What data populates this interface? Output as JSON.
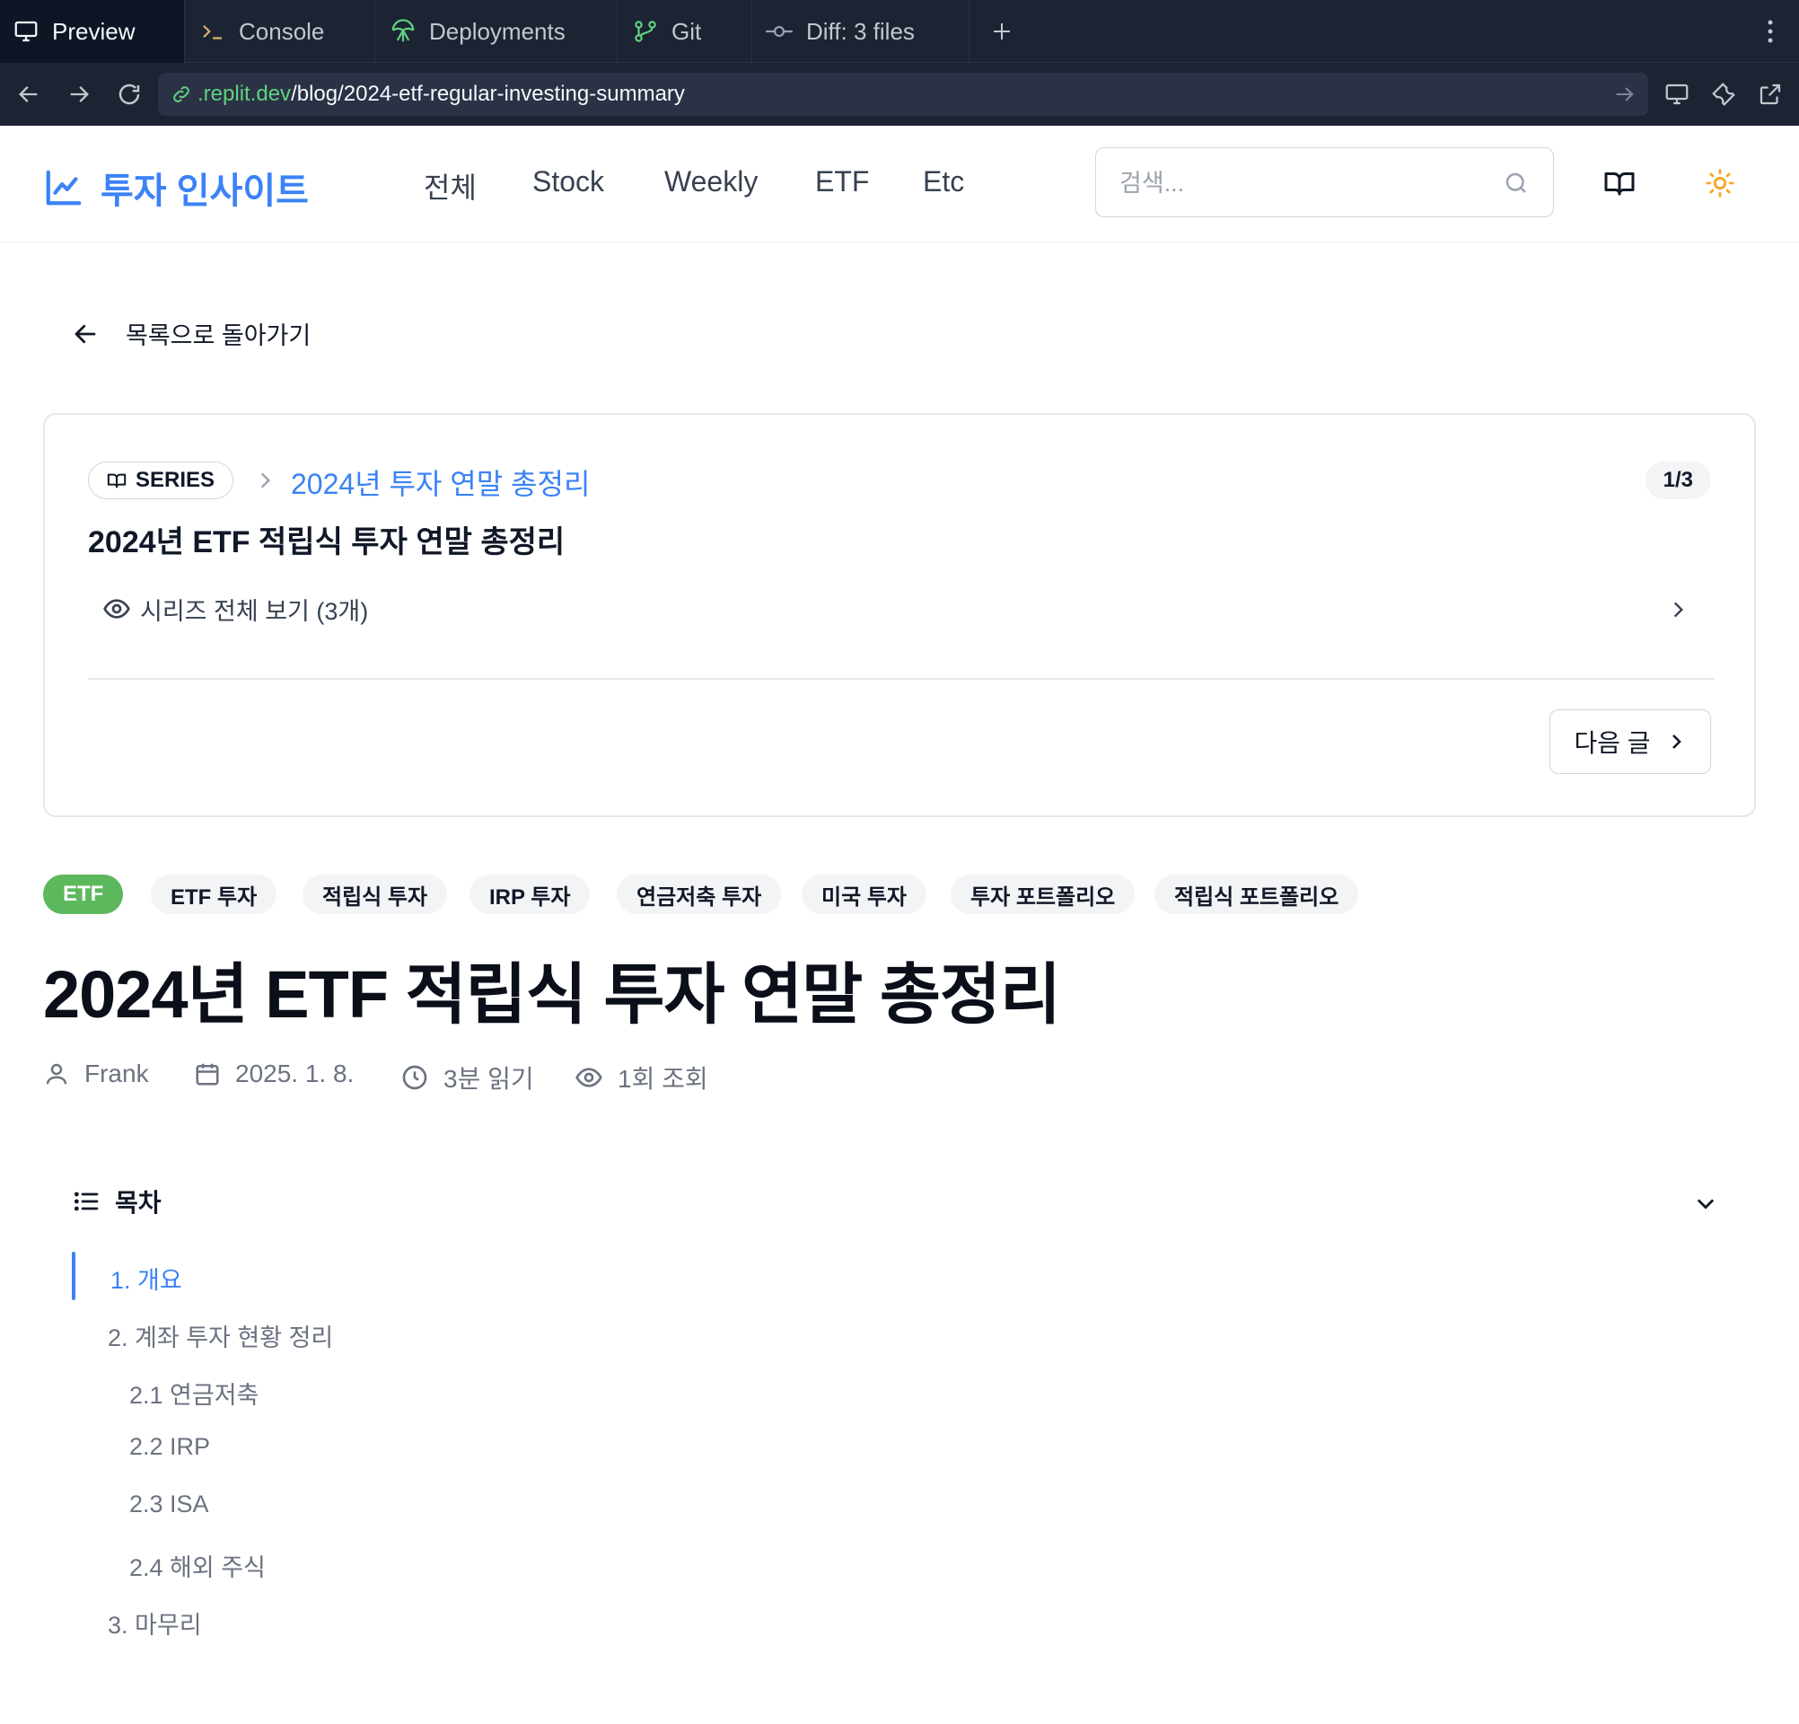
{
  "ide": {
    "tabs": [
      {
        "label": "Preview",
        "icon": "monitor-icon"
      },
      {
        "label": "Console",
        "icon": "terminal-icon"
      },
      {
        "label": "Deployments",
        "icon": "deployments-icon"
      },
      {
        "label": "Git",
        "icon": "git-branch-icon"
      },
      {
        "label": "Diff: 3 files",
        "icon": "git-commit-icon"
      }
    ],
    "url": {
      "host": ".replit.dev",
      "path": "/blog/2024-etf-regular-investing-summary"
    }
  },
  "site": {
    "logo": "투자 인사이트",
    "nav": [
      "전체",
      "Stock",
      "Weekly",
      "ETF",
      "Etc"
    ],
    "search_placeholder": "검색..."
  },
  "back_label": "목록으로 돌아가기",
  "series": {
    "badge": "SERIES",
    "name": "2024년 투자 연말 총정리",
    "count": "1/3",
    "post_title": "2024년 ETF 적립식 투자 연말 총정리",
    "view_all": "시리즈 전체 보기 (3개)",
    "next": "다음 글"
  },
  "tags": [
    "ETF",
    "ETF 투자",
    "적립식 투자",
    "IRP 투자",
    "연금저축 투자",
    "미국 투자",
    "투자 포트폴리오",
    "적립식 포트폴리오"
  ],
  "article": {
    "title": "2024년 ETF 적립식 투자 연말 총정리",
    "author": "Frank",
    "date": "2025. 1. 8.",
    "read_time": "3분 읽기",
    "views": "1회 조회"
  },
  "toc": {
    "title": "목차",
    "items": [
      "1. 개요",
      "2. 계좌 투자 현황 정리",
      "2.1 연금저축",
      "2.2 IRP",
      "2.3 ISA",
      "2.4 해외 주식",
      "3. 마무리"
    ]
  },
  "colors": {
    "accent": "#3b82f6",
    "tag_primary": "#5cb85c",
    "ide_bg": "#1c2333"
  }
}
